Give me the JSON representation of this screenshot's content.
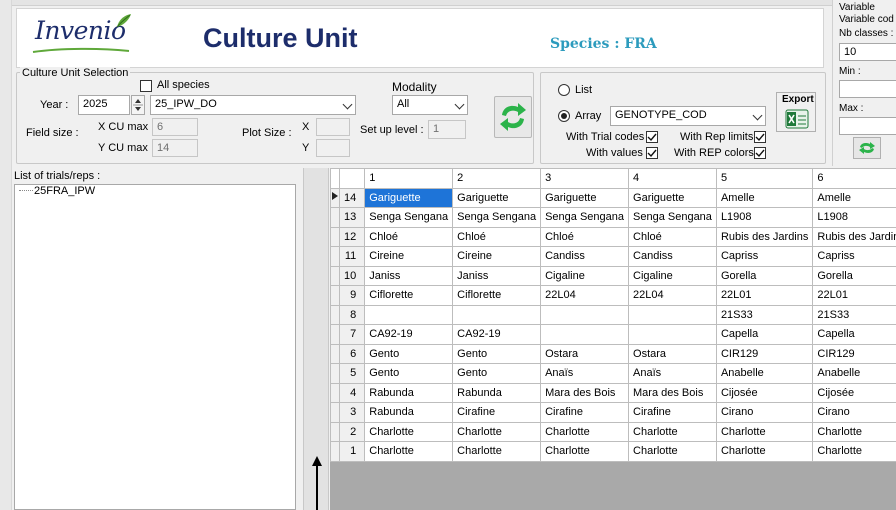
{
  "header": {
    "logo_text": "Invenio",
    "title": "Culture Unit",
    "species": "Species : FRA"
  },
  "selection": {
    "group_title": "Culture Unit Selection",
    "all_species_label": "All species",
    "year_label": "Year :",
    "year_value": "2025",
    "cu_value": "25_IPW_DO",
    "field_size_label": "Field size :",
    "x_cu_max_label": "X CU max :",
    "x_cu_max_value": "6",
    "y_cu_max_label": "Y CU max :",
    "y_cu_max_value": "14",
    "plot_size_label": "Plot Size :",
    "plot_x_label": "X",
    "plot_y_label": "Y",
    "modality_label": "Modality",
    "modality_value": "All",
    "setup_label": "Set up level :",
    "setup_value": "1"
  },
  "display": {
    "list_label": "List",
    "array_label": "Array",
    "array_value": "GENOTYPE_COD",
    "trial_codes_label": "With Trial codes",
    "values_label": "With values",
    "rep_limits_label": "With Rep limits",
    "rep_colors_label": "With REP colors",
    "export_label": "Export"
  },
  "right_panel": {
    "variable_label": "Variable",
    "variable_code_label": "Variable cod",
    "nb_classes_label": "Nb classes :",
    "nb_classes_value": "10",
    "min_label": "Min :",
    "max_label": "Max :"
  },
  "trials": {
    "title": "List of trials/reps :",
    "items": [
      "25FRA_IPW"
    ]
  },
  "grid": {
    "columns": [
      "1",
      "2",
      "3",
      "4",
      "5",
      "6"
    ],
    "rows": [
      {
        "num": "14",
        "cells": [
          "Gariguette",
          "Gariguette",
          "Gariguette",
          "Gariguette",
          "Amelle",
          "Amelle"
        ]
      },
      {
        "num": "13",
        "cells": [
          "Senga Sengana",
          "Senga Sengana",
          "Senga Sengana",
          "Senga Sengana",
          "L1908",
          "L1908"
        ]
      },
      {
        "num": "12",
        "cells": [
          "Chloé",
          "Chloé",
          "Chloé",
          "Chloé",
          "Rubis des Jardins",
          "Rubis des Jardins"
        ]
      },
      {
        "num": "11",
        "cells": [
          "Cireine",
          "Cireine",
          "Candiss",
          "Candiss",
          "Capriss",
          "Capriss"
        ]
      },
      {
        "num": "10",
        "cells": [
          "Janiss",
          "Janiss",
          "Cigaline",
          "Cigaline",
          "Gorella",
          "Gorella"
        ]
      },
      {
        "num": "9",
        "cells": [
          "Ciflorette",
          "Ciflorette",
          "22L04",
          "22L04",
          "22L01",
          "22L01"
        ]
      },
      {
        "num": "8",
        "cells": [
          "",
          "",
          "",
          "",
          "21S33",
          "21S33"
        ]
      },
      {
        "num": "7",
        "cells": [
          "CA92-19",
          "CA92-19",
          "",
          "",
          "Capella",
          "Capella"
        ]
      },
      {
        "num": "6",
        "cells": [
          "Gento",
          "Gento",
          "Ostara",
          "Ostara",
          "CIR129",
          "CIR129"
        ]
      },
      {
        "num": "5",
        "cells": [
          "Gento",
          "Gento",
          "Anaïs",
          "Anaïs",
          "Anabelle",
          "Anabelle"
        ]
      },
      {
        "num": "4",
        "cells": [
          "Rabunda",
          "Rabunda",
          "Mara des Bois",
          "Mara des Bois",
          "Cijosée",
          "Cijosée"
        ]
      },
      {
        "num": "3",
        "cells": [
          "Rabunda",
          "Cirafine",
          "Cirafine",
          "Cirafine",
          "Cirano",
          "Cirano"
        ]
      },
      {
        "num": "2",
        "cells": [
          "Charlotte",
          "Charlotte",
          "Charlotte",
          "Charlotte",
          "Charlotte",
          "Charlotte"
        ]
      },
      {
        "num": "1",
        "cells": [
          "Charlotte",
          "Charlotte",
          "Charlotte",
          "Charlotte",
          "Charlotte",
          "Charlotte"
        ]
      }
    ]
  },
  "colors": {
    "title": "#1d2d6b",
    "species": "#2c9bbd",
    "selected_cell": "#1e74d8",
    "refresh_green": "#2bb34a",
    "excel_green": "#1f7a3a"
  }
}
